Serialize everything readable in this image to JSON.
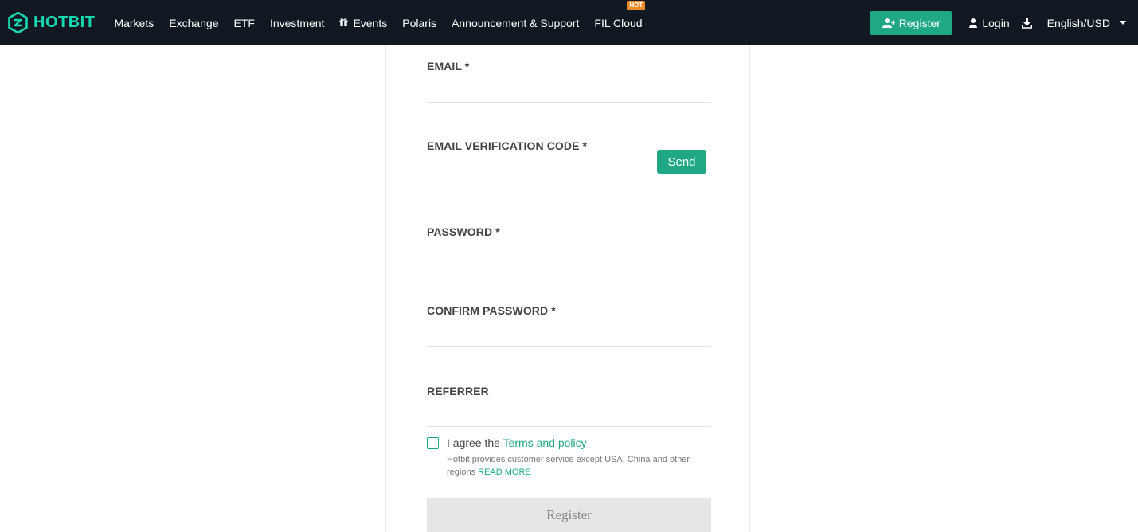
{
  "brand": {
    "name": "HOTBIT",
    "accent": "#18d8b4",
    "green": "#1fa883",
    "hot_color": "#f08a24"
  },
  "nav": {
    "items": [
      {
        "label": "Markets",
        "icon": ""
      },
      {
        "label": "Exchange",
        "icon": ""
      },
      {
        "label": "ETF",
        "icon": ""
      },
      {
        "label": "Investment",
        "icon": ""
      },
      {
        "label": "Events",
        "icon": "gift-icon"
      },
      {
        "label": "Polaris",
        "icon": ""
      },
      {
        "label": "Announcement & Support",
        "icon": ""
      },
      {
        "label": "FIL Cloud",
        "icon": "",
        "badge": "HOT"
      }
    ],
    "register_label": "Register",
    "login_label": "Login",
    "language_label": "English/USD"
  },
  "form": {
    "email_label": "EMAIL *",
    "email_code_label": "EMAIL VERIFICATION CODE *",
    "send_label": "Send",
    "password_label": "PASSWORD *",
    "confirm_password_label": "CONFIRM PASSWORD *",
    "referrer_label": "REFERRER",
    "agree_prefix": "I agree the ",
    "terms_link": "Terms and policy",
    "note_text": "Hotbit provides customer service except USA, China and other regions ",
    "read_more": "READ MORE",
    "register_label": "Register"
  }
}
